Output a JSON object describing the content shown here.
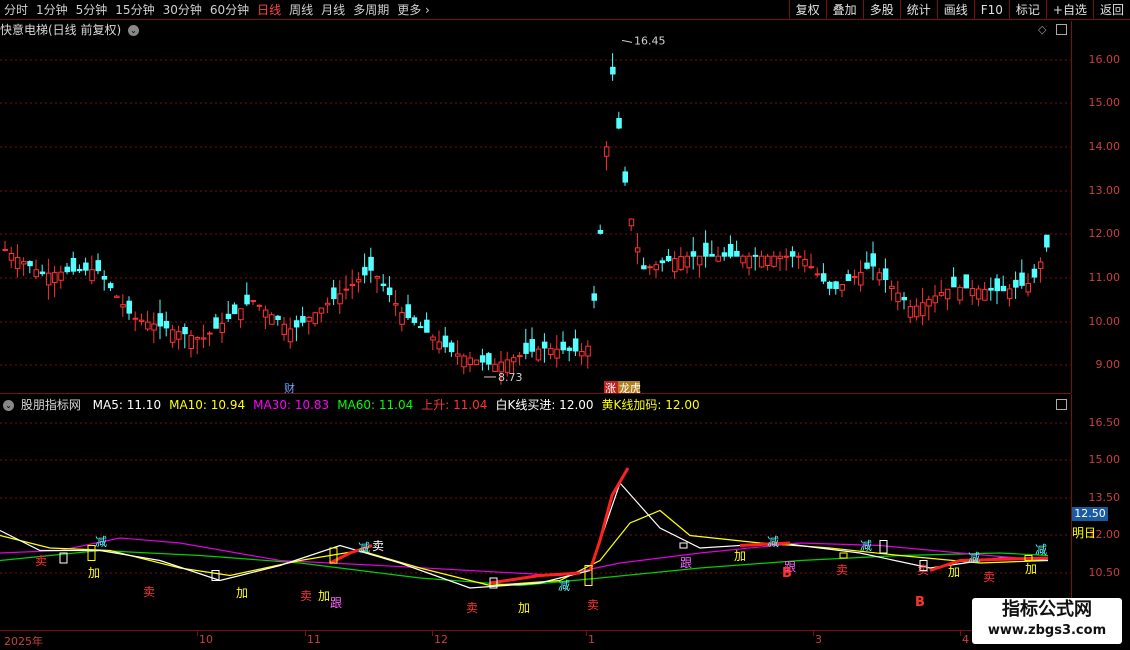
{
  "toolbar": {
    "periods": [
      "分时",
      "1分钟",
      "5分钟",
      "15分钟",
      "30分钟",
      "60分钟",
      "日线",
      "周线",
      "月线",
      "多周期",
      "更多"
    ],
    "active_period": "日线",
    "more_icon": "chevron-right-icon",
    "tools": [
      "复权",
      "叠加",
      "多股",
      "统计",
      "画线",
      "F10",
      "标记",
      "+自选",
      "返回"
    ]
  },
  "main_panel": {
    "title": "快意电梯(日线 前复权)",
    "axis_ticks": [
      "16.00",
      "15.00",
      "14.00",
      "13.00",
      "12.00",
      "11.00",
      "10.00",
      "9.00"
    ],
    "high_label": "16.45",
    "low_label": "8.73",
    "badges": [
      "财",
      "涨",
      "龙虎"
    ],
    "colors": {
      "up": "#ff3232",
      "down": "#54ffff",
      "grid": "#7a1010"
    }
  },
  "indicator_panel": {
    "name": "股朋指标网",
    "items": [
      {
        "label": "MA5:",
        "value": "11.10",
        "color": "#ffffff"
      },
      {
        "label": "MA10:",
        "value": "10.94",
        "color": "#ffff00"
      },
      {
        "label": "MA30:",
        "value": "10.83",
        "color": "#ff00ff"
      },
      {
        "label": "MA60:",
        "value": "11.04",
        "color": "#00ff00"
      },
      {
        "label": "上升:",
        "value": "11.04",
        "color": "#ff3232"
      },
      {
        "label": "白K线买进:",
        "value": "12.00",
        "color": "#ffffff"
      },
      {
        "label": "黄K线加码:",
        "value": "12.00",
        "color": "#ffff00"
      }
    ],
    "axis_ticks": [
      "16.50",
      "15.00",
      "13.50",
      "12.00",
      "10.50"
    ],
    "current_value": "12.50",
    "right_label": "明日",
    "signal_labels": {
      "sell": "卖",
      "add": "加",
      "reduce": "减",
      "follow": "跟",
      "buy": "B"
    }
  },
  "date_axis": [
    "2025年",
    "10",
    "11",
    "12",
    "1",
    "3",
    "4"
  ],
  "watermark": {
    "line1": "指标公式网",
    "line2": "www.zbgs3.com"
  }
}
